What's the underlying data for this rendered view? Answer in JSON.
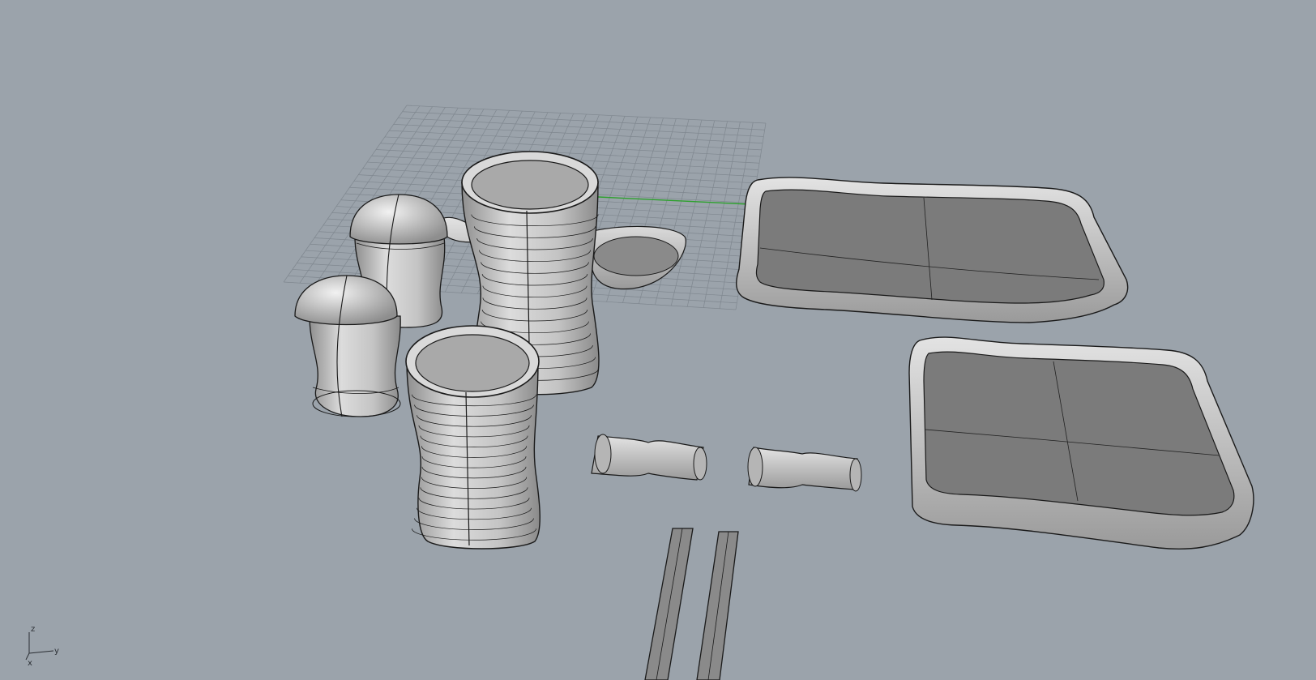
{
  "viewport": {
    "name": "Perspective",
    "background_color": "#9ba3ab",
    "grid_color": "#7f878f",
    "x_axis_color": "#8a4a4a",
    "y_axis_color": "#2da12d",
    "object_fill": "#c9c9c9",
    "object_dark": "#7b7b7b",
    "wire_color": "#1a1a1a"
  },
  "axes_widget": {
    "z_label": "z",
    "y_label": "y",
    "x_label": "x"
  },
  "objects": [
    {
      "name": "cup-large-back"
    },
    {
      "name": "cup-large-front"
    },
    {
      "name": "shaker-back"
    },
    {
      "name": "shaker-front"
    },
    {
      "name": "spoon"
    },
    {
      "name": "tray-top"
    },
    {
      "name": "tray-bottom"
    },
    {
      "name": "chopstick-rest-left"
    },
    {
      "name": "chopstick-rest-right"
    },
    {
      "name": "chopstick-left"
    },
    {
      "name": "chopstick-right"
    }
  ]
}
